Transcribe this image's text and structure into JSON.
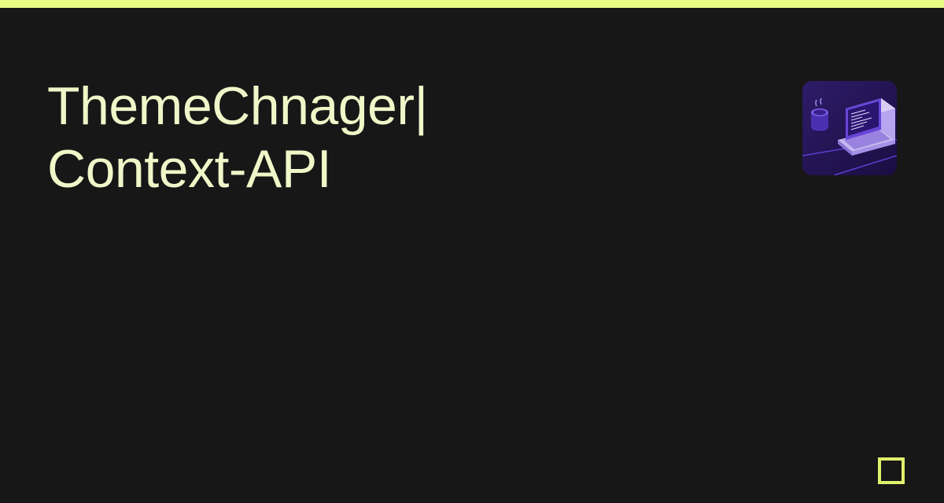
{
  "accent_color": "#e7fb85",
  "title_line1": "ThemeChnager|",
  "title_line2": "Context-API",
  "icon_semantic": "laptop-coffee-isometric-icon"
}
